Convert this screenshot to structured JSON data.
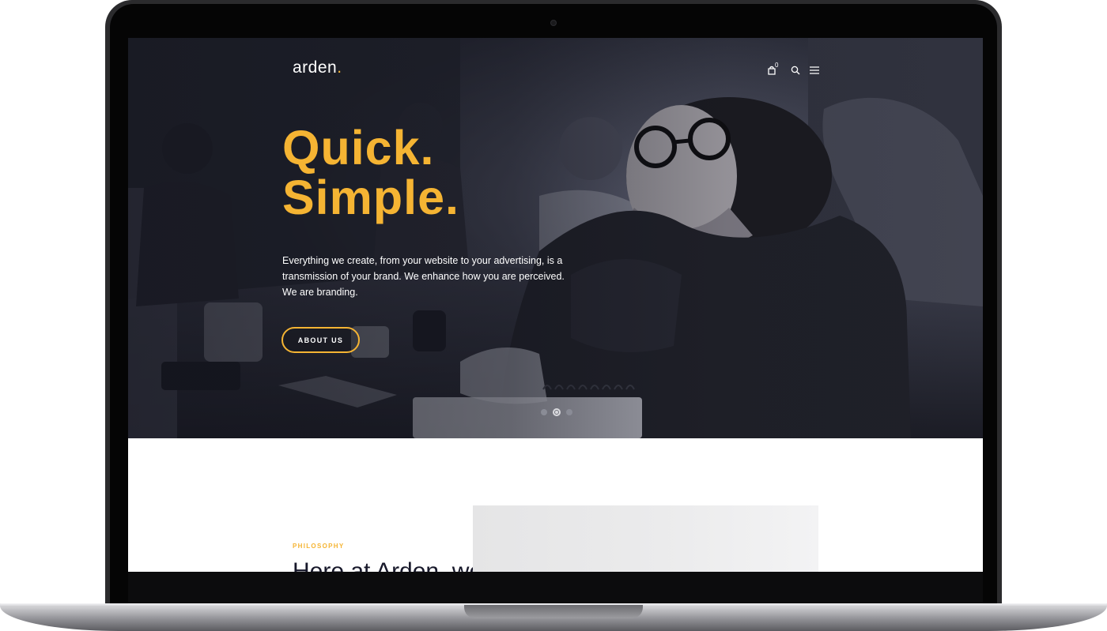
{
  "site": {
    "logo_text": "arden",
    "logo_dot": ".",
    "accent_color": "#f5b433",
    "icons": [
      "cart-icon",
      "search-icon",
      "menu-icon"
    ],
    "cart_count": "0"
  },
  "hero": {
    "headline_line1": "Quick.",
    "headline_line2": "Simple.",
    "lead_text": "Everything we create, from your website to your advertising, is a transmission of your brand. We enhance how you are perceived. We are branding.",
    "button_label": "ABOUT US",
    "slide_count": 3,
    "active_slide": 2
  },
  "philosophy": {
    "eyebrow": "PHILOSOPHY",
    "heading": "Here at Arden, we"
  }
}
